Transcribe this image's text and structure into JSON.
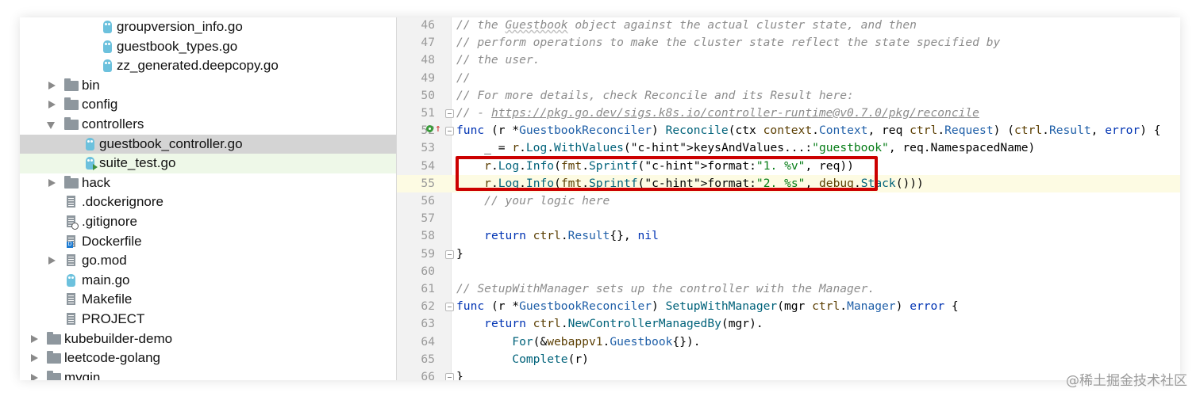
{
  "project_tree": {
    "items": [
      {
        "label": "groupversion_info.go",
        "kind": "go-file",
        "arrow": "none"
      },
      {
        "label": "guestbook_types.go",
        "kind": "go-file",
        "arrow": "none"
      },
      {
        "label": "zz_generated.deepcopy.go",
        "kind": "go-file",
        "arrow": "none"
      },
      {
        "label": "bin",
        "kind": "folder",
        "arrow": "collapsed"
      },
      {
        "label": "config",
        "kind": "folder",
        "arrow": "collapsed"
      },
      {
        "label": "controllers",
        "kind": "folder",
        "arrow": "expanded"
      },
      {
        "label": "guestbook_controller.go",
        "kind": "go-file",
        "arrow": "none",
        "state": "selected"
      },
      {
        "label": "suite_test.go",
        "kind": "go-test-file",
        "arrow": "none",
        "state": "highlighted"
      },
      {
        "label": "hack",
        "kind": "folder",
        "arrow": "collapsed"
      },
      {
        "label": ".dockerignore",
        "kind": "text-file",
        "arrow": "none"
      },
      {
        "label": ".gitignore",
        "kind": "ignore-file",
        "arrow": "none"
      },
      {
        "label": "Dockerfile",
        "kind": "docker-file",
        "arrow": "none"
      },
      {
        "label": "go.mod",
        "kind": "text-file",
        "arrow": "collapsed"
      },
      {
        "label": "main.go",
        "kind": "go-file",
        "arrow": "none"
      },
      {
        "label": "Makefile",
        "kind": "text-file",
        "arrow": "none"
      },
      {
        "label": "PROJECT",
        "kind": "text-file",
        "arrow": "none"
      },
      {
        "label": "kubebuilder-demo",
        "kind": "folder",
        "arrow": "collapsed"
      },
      {
        "label": "leetcode-golang",
        "kind": "folder",
        "arrow": "collapsed"
      },
      {
        "label": "mygin",
        "kind": "folder",
        "arrow": "collapsed"
      }
    ]
  },
  "editor": {
    "lines": [
      {
        "num": "46",
        "text": "// the Guestbook object against the actual cluster state, and then"
      },
      {
        "num": "47",
        "text": "// perform operations to make the cluster state reflect the state specified by"
      },
      {
        "num": "48",
        "text": "// the user."
      },
      {
        "num": "49",
        "text": "//"
      },
      {
        "num": "50",
        "text": "// For more details, check Reconcile and its Result here:"
      },
      {
        "num": "51",
        "text": "// - https://pkg.go.dev/sigs.k8s.io/controller-runtime@v0.7.0/pkg/reconcile"
      },
      {
        "num": "52",
        "text": "func (r *GuestbookReconciler) Reconcile(ctx context.Context, req ctrl.Request) (ctrl.Result, error) {"
      },
      {
        "num": "53",
        "text": "    _ = r.Log.WithValues( keysAndValues...: \"guestbook\", req.NamespacedName)"
      },
      {
        "num": "54",
        "text": "    r.Log.Info(fmt.Sprintf( format: \"1. %v\", req))"
      },
      {
        "num": "55",
        "text": "    r.Log.Info(fmt.Sprintf( format: \"2. %s\", debug.Stack()))"
      },
      {
        "num": "56",
        "text": "    // your logic here"
      },
      {
        "num": "57",
        "text": ""
      },
      {
        "num": "58",
        "text": "    return ctrl.Result{}, nil"
      },
      {
        "num": "59",
        "text": "}"
      },
      {
        "num": "60",
        "text": ""
      },
      {
        "num": "61",
        "text": "// SetupWithManager sets up the controller with the Manager."
      },
      {
        "num": "62",
        "text": "func (r *GuestbookReconciler) SetupWithManager(mgr ctrl.Manager) error {"
      },
      {
        "num": "63",
        "text": "    return ctrl.NewControllerManagedBy(mgr)."
      },
      {
        "num": "64",
        "text": "        For(&webappv1.Guestbook{})."
      },
      {
        "num": "65",
        "text": "        Complete(r)"
      },
      {
        "num": "66",
        "text": "}"
      }
    ],
    "current_line": "55",
    "annotation_box_color": "#cc0000"
  },
  "watermark": "@稀土掘金技术社区"
}
